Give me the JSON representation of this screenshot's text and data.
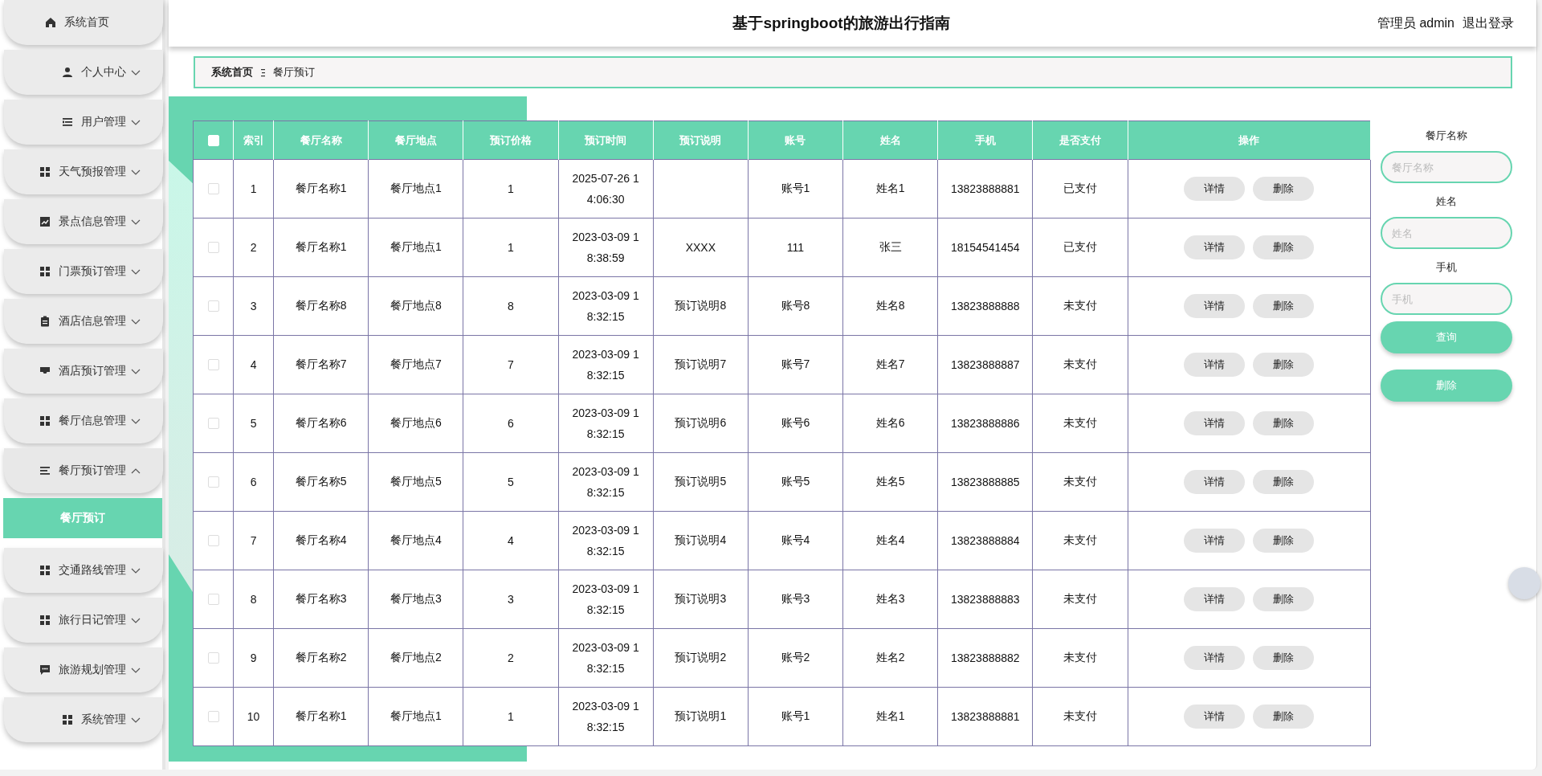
{
  "header": {
    "title": "基于springboot的旅游出行指南",
    "user_label": "管理员 admin",
    "logout": "退出登录"
  },
  "sidebar": {
    "items": [
      {
        "label": "系统首页",
        "kind": "link"
      },
      {
        "label": "个人中心",
        "kind": "menu",
        "expanded": false
      },
      {
        "label": "用户管理",
        "kind": "menu",
        "expanded": false
      },
      {
        "label": "天气预报管理",
        "kind": "menu",
        "expanded": false
      },
      {
        "label": "景点信息管理",
        "kind": "menu",
        "expanded": false
      },
      {
        "label": "门票预订管理",
        "kind": "menu",
        "expanded": false
      },
      {
        "label": "酒店信息管理",
        "kind": "menu",
        "expanded": false
      },
      {
        "label": "酒店预订管理",
        "kind": "menu",
        "expanded": false
      },
      {
        "label": "餐厅信息管理",
        "kind": "menu",
        "expanded": false
      },
      {
        "label": "餐厅预订管理",
        "kind": "menu",
        "expanded": true,
        "children": [
          {
            "label": "餐厅预订",
            "selected": true
          }
        ]
      },
      {
        "label": "交通路线管理",
        "kind": "menu",
        "expanded": false
      },
      {
        "label": "旅行日记管理",
        "kind": "menu",
        "expanded": false
      },
      {
        "label": "旅游规划管理",
        "kind": "menu",
        "expanded": false
      },
      {
        "label": "系统管理",
        "kind": "menu",
        "expanded": false
      }
    ]
  },
  "breadcrumb": [
    "系统首页",
    "餐厅预订"
  ],
  "table": {
    "select_all": {
      "checked": false
    },
    "columns": [
      "索引",
      "餐厅名称",
      "餐厅地点",
      "预订价格",
      "预订时间",
      "预订说明",
      "账号",
      "姓名",
      "手机",
      "是否支付",
      "操作"
    ],
    "rows": [
      {
        "selected": false,
        "cells": [
          "1",
          "餐厅名称1",
          "餐厅地点1",
          "1",
          "2025-07-26 14:06:30",
          "",
          "账号1",
          "姓名1",
          "13823888881",
          "已支付"
        ],
        "actions": [
          "详情",
          "删除"
        ]
      },
      {
        "selected": false,
        "cells": [
          "2",
          "餐厅名称1",
          "餐厅地点1",
          "1",
          "2023-03-09 18:38:59",
          "XXXX",
          "111",
          "张三",
          "18154541454",
          "已支付"
        ],
        "actions": [
          "详情",
          "删除"
        ]
      },
      {
        "selected": false,
        "cells": [
          "3",
          "餐厅名称8",
          "餐厅地点8",
          "8",
          "2023-03-09 18:32:15",
          "预订说明8",
          "账号8",
          "姓名8",
          "13823888888",
          "未支付"
        ],
        "actions": [
          "详情",
          "删除"
        ]
      },
      {
        "selected": false,
        "cells": [
          "4",
          "餐厅名称7",
          "餐厅地点7",
          "7",
          "2023-03-09 18:32:15",
          "预订说明7",
          "账号7",
          "姓名7",
          "13823888887",
          "未支付"
        ],
        "actions": [
          "详情",
          "删除"
        ]
      },
      {
        "selected": false,
        "cells": [
          "5",
          "餐厅名称6",
          "餐厅地点6",
          "6",
          "2023-03-09 18:32:15",
          "预订说明6",
          "账号6",
          "姓名6",
          "13823888886",
          "未支付"
        ],
        "actions": [
          "详情",
          "删除"
        ]
      },
      {
        "selected": false,
        "cells": [
          "6",
          "餐厅名称5",
          "餐厅地点5",
          "5",
          "2023-03-09 18:32:15",
          "预订说明5",
          "账号5",
          "姓名5",
          "13823888885",
          "未支付"
        ],
        "actions": [
          "详情",
          "删除"
        ]
      },
      {
        "selected": false,
        "cells": [
          "7",
          "餐厅名称4",
          "餐厅地点4",
          "4",
          "2023-03-09 18:32:15",
          "预订说明4",
          "账号4",
          "姓名4",
          "13823888884",
          "未支付"
        ],
        "actions": [
          "详情",
          "删除"
        ]
      },
      {
        "selected": false,
        "cells": [
          "8",
          "餐厅名称3",
          "餐厅地点3",
          "3",
          "2023-03-09 18:32:15",
          "预订说明3",
          "账号3",
          "姓名3",
          "13823888883",
          "未支付"
        ],
        "actions": [
          "详情",
          "删除"
        ]
      },
      {
        "selected": false,
        "cells": [
          "9",
          "餐厅名称2",
          "餐厅地点2",
          "2",
          "2023-03-09 18:32:15",
          "预订说明2",
          "账号2",
          "姓名2",
          "13823888882",
          "未支付"
        ],
        "actions": [
          "详情",
          "删除"
        ]
      },
      {
        "selected": false,
        "cells": [
          "10",
          "餐厅名称1",
          "餐厅地点1",
          "1",
          "2023-03-09 18:32:15",
          "预订说明1",
          "账号1",
          "姓名1",
          "13823888881",
          "未支付"
        ],
        "actions": [
          "详情",
          "删除"
        ]
      }
    ]
  },
  "search": {
    "fields": [
      {
        "label": "餐厅名称",
        "placeholder": "餐厅名称"
      },
      {
        "label": "姓名",
        "placeholder": "姓名"
      },
      {
        "label": "手机",
        "placeholder": "手机"
      }
    ],
    "buttons": [
      "查询",
      "删除"
    ]
  }
}
